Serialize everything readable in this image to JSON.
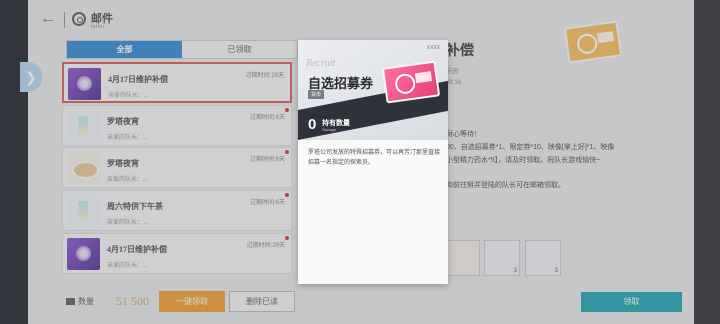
{
  "header": {
    "title": "邮件",
    "subtitle": "letter",
    "back_glyph": "←",
    "close_glyph": "✕"
  },
  "tabs": [
    {
      "label": "全部",
      "active": true
    },
    {
      "label": "已领取",
      "active": false
    }
  ],
  "side_arrow_glyph": "❯",
  "mail_list": [
    {
      "title": "4月17日维护补偿",
      "sub": "亲爱的队长：...",
      "expire": "过期时间:29天",
      "thumb": "purple",
      "selected": true,
      "unread": false
    },
    {
      "title": "罗塔夜宵",
      "sub": "亲爱的队长：...",
      "expire": "过期时间:6天",
      "thumb": "drink",
      "selected": false,
      "unread": true
    },
    {
      "title": "罗塔夜宵",
      "sub": "亲爱的队长：...",
      "expire": "过期时间:6天",
      "thumb": "food",
      "selected": false,
      "unread": true
    },
    {
      "title": "周六特供下午茶",
      "sub": "亲爱的队长：...",
      "expire": "过期时间:6天",
      "thumb": "drink",
      "selected": false,
      "unread": true
    },
    {
      "title": "4月17日维护补偿",
      "sub": "亲爱的队长：...",
      "expire": "过期时间:29天",
      "thumb": "purple",
      "selected": false,
      "unread": true
    }
  ],
  "bottom": {
    "count_label": "数量",
    "count_value": "51 500",
    "claim_all": "一键领取",
    "delete_read": "删除已读"
  },
  "detail": {
    "title": "补偿",
    "from": "乐园",
    "time": "08:16",
    "body_line1": "耐心等待！",
    "body_line2": "00、自选招募券*1、限定券*10、映像[掌上好]*1、映像",
    "body_line3": "小型精力药水*5】，请及时领取。祝队长游戏愉快~",
    "body_line4": "和前往掰并登陆的队长可在邮箱领取。",
    "attachments": [
      {
        "kind": "food",
        "amount": ""
      },
      {
        "kind": "drink1",
        "amount": "3"
      },
      {
        "kind": "drink2",
        "amount": "3"
      },
      {
        "kind": "ticket",
        "amount": ""
      }
    ],
    "receive_button": "领取"
  },
  "popup": {
    "brand": "XXXX",
    "script": "Recruit",
    "name": "自选招募券",
    "tag": "货币",
    "hold_count": "0",
    "hold_label": "持有数量",
    "hold_sub": "Storage",
    "description": "罗塔公司发放的特殊招募券，可以再芳汀那里直接招募一名指定的探索员。"
  },
  "colors": {
    "tab_active": "#3d8fd6",
    "claim_all": "#f0a23c",
    "receive": "#2ea6b5",
    "selected_border": "#e0605a",
    "unread_dot": "#e23a3a"
  }
}
